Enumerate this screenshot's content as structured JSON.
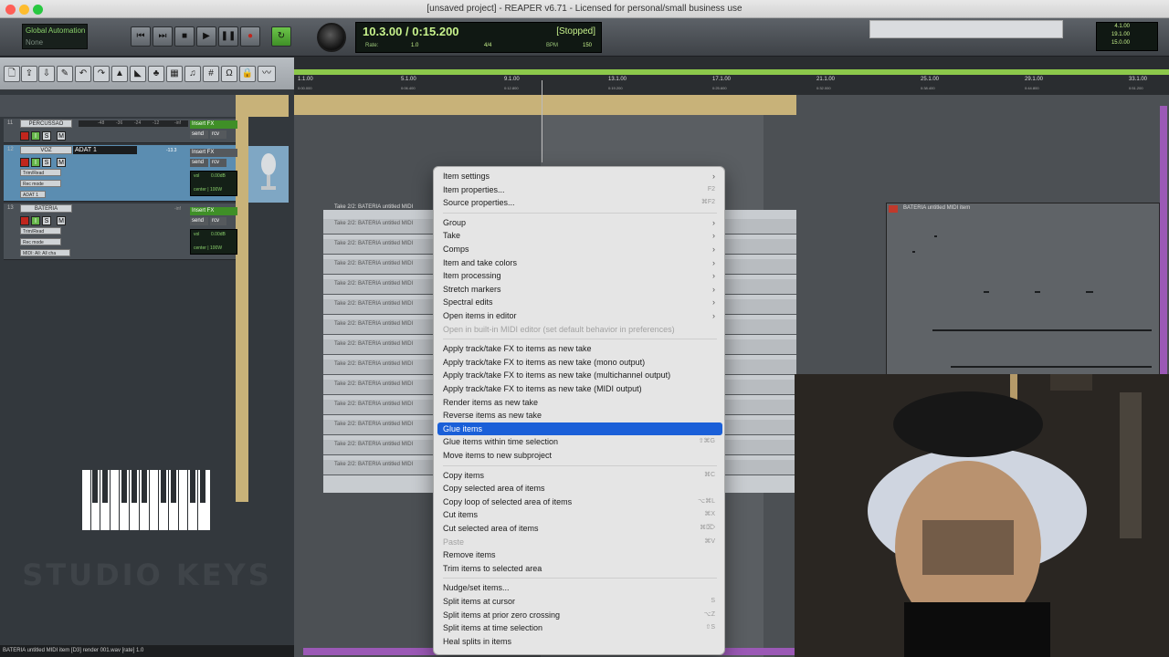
{
  "window": {
    "title": "[unsaved project] - REAPER v6.71 - Licensed for personal/small business use"
  },
  "transport": {
    "automation_mode": "Global Automation",
    "automation_value": "None",
    "time": "10.3.00 / 0:15.200",
    "state": "[Stopped]",
    "rate_label": "Rate:",
    "rate_value": "1.0",
    "timesig": "4/4",
    "bpm_label": "BPM",
    "bpm_value": "150",
    "selection": [
      "4.1.00",
      "19.1.00",
      "15.0.00"
    ]
  },
  "ruler": {
    "ticks": [
      "1.1.00",
      "5.1.00",
      "9.1.00",
      "13.1.00",
      "17.1.00",
      "21.1.00",
      "25.1.00",
      "29.1.00",
      "33.1.00"
    ],
    "subs": [
      "0:00.000",
      "0:06.400",
      "0:12.800",
      "0:19.200",
      "0:25.600",
      "0:32.000",
      "0:38.400",
      "0:44.800",
      "0:51.200"
    ]
  },
  "tracks": [
    {
      "num": "11",
      "name": "PERCUSSAO",
      "fx": "Insert FX",
      "send": "send",
      "rcv": "rcv",
      "meter_val": "-inf"
    },
    {
      "num": "12",
      "name": "VOZ",
      "input": "ADAT 1",
      "fx": "Insert FX",
      "send": "send",
      "rcv": "rcv",
      "mode": "Trim/Read",
      "rec": "Rec mode",
      "input2": "ADAT 1",
      "vol": "vol",
      "vol_db": "0.00dB",
      "pan": "center | 100W",
      "meter_val": "-13.3"
    },
    {
      "num": "13",
      "name": "BATERIA",
      "fx": "Insert FX",
      "send": "send",
      "rcv": "rcv",
      "mode": "Trim/Read",
      "rec": "Rec mode",
      "input2": "MIDI: All: All cha",
      "vol": "vol",
      "vol_db": "0.00dB",
      "pan": "center | 100W",
      "meter_val": "-inf"
    }
  ],
  "meter_ticks": [
    "-48",
    "-36",
    "-24",
    "-12"
  ],
  "buttons": {
    "mute": "M",
    "solo": "S",
    "fx": "I"
  },
  "items": {
    "drum_take_label": "Take 2/2: BATERIA untitled MIDI",
    "drum_lane_label": "Take 2/2: BATERIA untitled MIDI",
    "midi_item_label": "BATERIA untitled MIDI item"
  },
  "status_bar": "BATERIA untitled MIDI item [D3] render 001.wav [rate] 1.0",
  "logo_text": "STUDIO KEYS",
  "context_menu": {
    "groups": [
      [
        {
          "label": "Item settings",
          "submenu": true
        },
        {
          "label": "Item properties...",
          "shortcut": "F2"
        },
        {
          "label": "Source properties...",
          "shortcut": "⌘F2"
        }
      ],
      [
        {
          "label": "Group",
          "submenu": true
        },
        {
          "label": "Take",
          "submenu": true
        },
        {
          "label": "Comps",
          "submenu": true
        },
        {
          "label": "Item and take colors",
          "submenu": true
        },
        {
          "label": "Item processing",
          "submenu": true
        },
        {
          "label": "Stretch markers",
          "submenu": true
        },
        {
          "label": "Spectral edits",
          "submenu": true
        },
        {
          "label": "Open items in editor",
          "submenu": true
        },
        {
          "label": "Open in built-in MIDI editor (set default behavior in preferences)",
          "disabled": true
        }
      ],
      [
        {
          "label": "Apply track/take FX to items as new take"
        },
        {
          "label": "Apply track/take FX to items as new take (mono output)"
        },
        {
          "label": "Apply track/take FX to items as new take (multichannel output)"
        },
        {
          "label": "Apply track/take FX to items as new take (MIDI output)"
        },
        {
          "label": "Render items as new take"
        },
        {
          "label": "Reverse items as new take"
        },
        {
          "label": "Glue items",
          "highlighted": true
        },
        {
          "label": "Glue items within time selection",
          "shortcut": "⇧⌘G"
        },
        {
          "label": "Move items to new subproject"
        }
      ],
      [
        {
          "label": "Copy items",
          "shortcut": "⌘C"
        },
        {
          "label": "Copy selected area of items"
        },
        {
          "label": "Copy loop of selected area of items",
          "shortcut": "⌥⌘L"
        },
        {
          "label": "Cut items",
          "shortcut": "⌘X"
        },
        {
          "label": "Cut selected area of items",
          "shortcut": "⌘⌦"
        },
        {
          "label": "Paste",
          "shortcut": "⌘V",
          "disabled": true
        },
        {
          "label": "Remove items"
        },
        {
          "label": "Trim items to selected area"
        }
      ],
      [
        {
          "label": "Nudge/set items..."
        },
        {
          "label": "Split items at cursor",
          "shortcut": "S"
        },
        {
          "label": "Split items at prior zero crossing",
          "shortcut": "⌥Z"
        },
        {
          "label": "Split items at time selection",
          "shortcut": "⇧S"
        },
        {
          "label": "Heal splits in items"
        }
      ]
    ]
  },
  "colors": {
    "menu_highlight": "#1a5fd8",
    "ruler_band": "#8cc84b",
    "selected_track": "#5b8db1",
    "scrollbar": "#9b59b6"
  }
}
